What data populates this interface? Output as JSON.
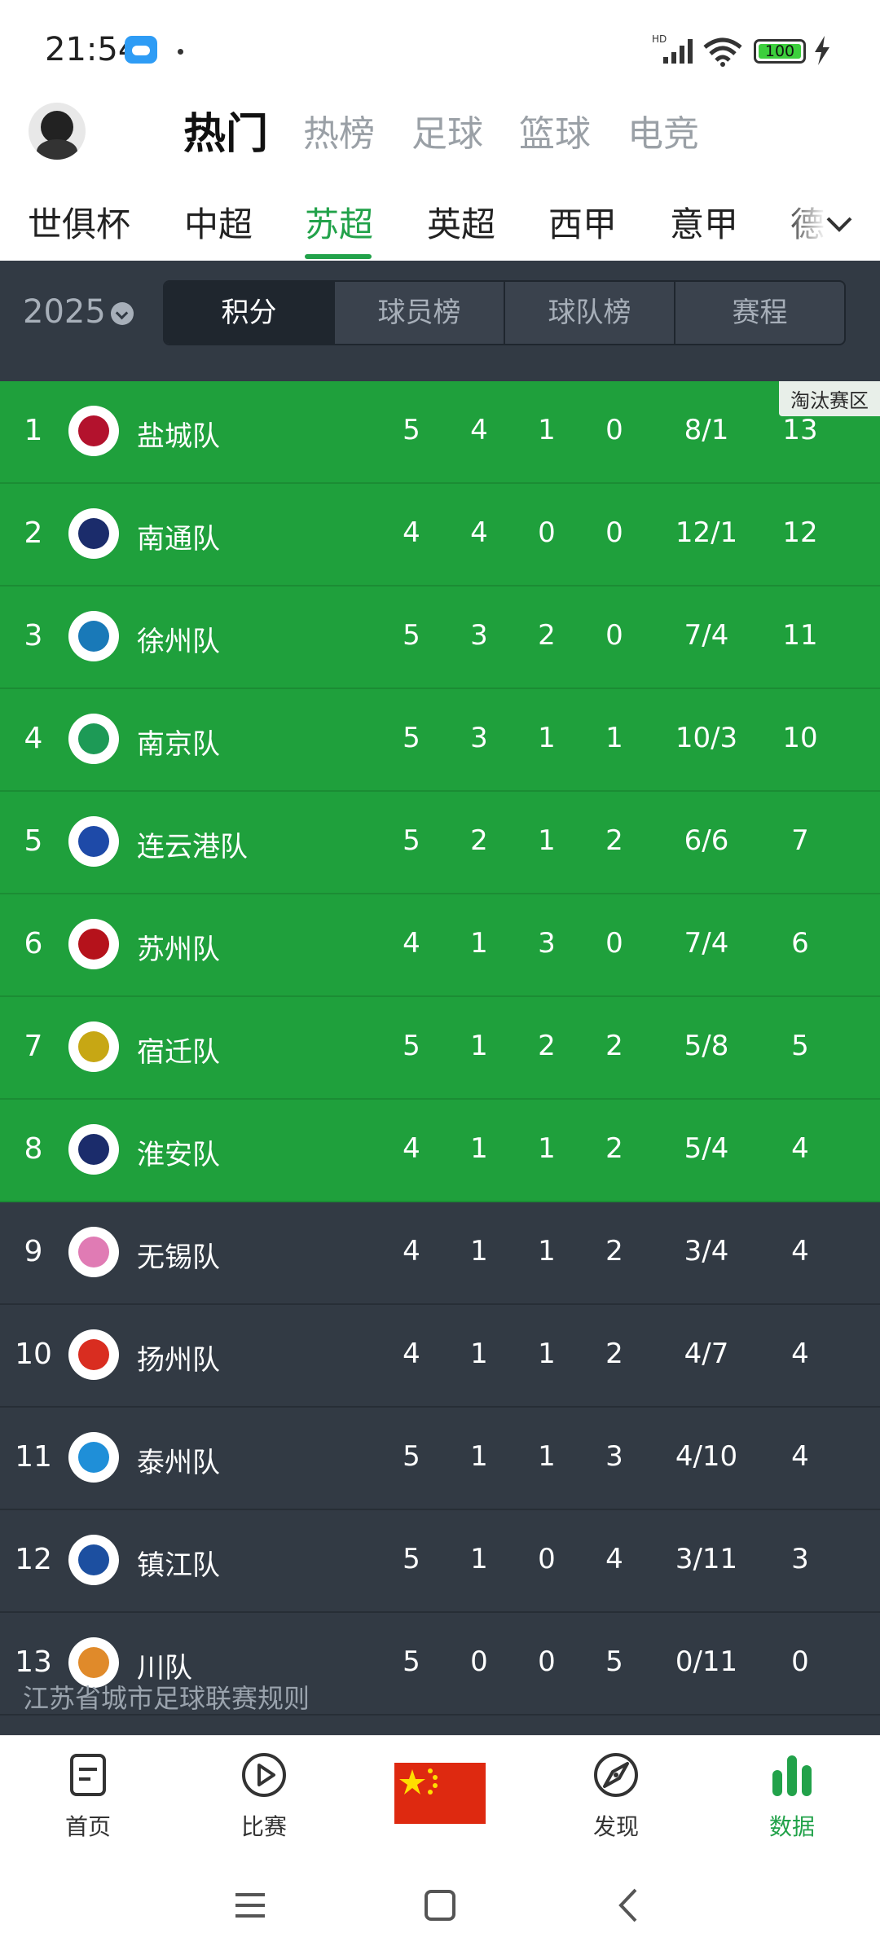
{
  "status_bar": {
    "time": "21:54",
    "battery": "100",
    "signal_label": "HD"
  },
  "top_tabs": [
    {
      "label": "热门",
      "active": true
    },
    {
      "label": "热榜",
      "active": false
    },
    {
      "label": "足球",
      "active": false
    },
    {
      "label": "篮球",
      "active": false
    },
    {
      "label": "电竞",
      "active": false
    }
  ],
  "league_tabs": [
    {
      "label": "世俱杯",
      "active": false
    },
    {
      "label": "中超",
      "active": false
    },
    {
      "label": "苏超",
      "active": true
    },
    {
      "label": "英超",
      "active": false
    },
    {
      "label": "西甲",
      "active": false
    },
    {
      "label": "意甲",
      "active": false
    },
    {
      "label": "德",
      "active": false
    }
  ],
  "season": "2025",
  "segments": [
    {
      "label": "积分",
      "active": true
    },
    {
      "label": "球员榜",
      "active": false
    },
    {
      "label": "球队榜",
      "active": false
    },
    {
      "label": "赛程",
      "active": false
    }
  ],
  "zone_tag": "淘汰赛区",
  "standings": [
    {
      "rank": "1",
      "team": "盐城队",
      "played": "5",
      "won": "4",
      "drawn": "1",
      "lost": "0",
      "goals": "8/1",
      "points": "13",
      "zone": "knockout",
      "logo_color": "#b3122d"
    },
    {
      "rank": "2",
      "team": "南通队",
      "played": "4",
      "won": "4",
      "drawn": "0",
      "lost": "0",
      "goals": "12/1",
      "points": "12",
      "zone": "knockout",
      "logo_color": "#1b2c6b"
    },
    {
      "rank": "3",
      "team": "徐州队",
      "played": "5",
      "won": "3",
      "drawn": "2",
      "lost": "0",
      "goals": "7/4",
      "points": "11",
      "zone": "knockout",
      "logo_color": "#1979b8"
    },
    {
      "rank": "4",
      "team": "南京队",
      "played": "5",
      "won": "3",
      "drawn": "1",
      "lost": "1",
      "goals": "10/3",
      "points": "10",
      "zone": "knockout",
      "logo_color": "#1d9a56"
    },
    {
      "rank": "5",
      "team": "连云港队",
      "played": "5",
      "won": "2",
      "drawn": "1",
      "lost": "2",
      "goals": "6/6",
      "points": "7",
      "zone": "knockout",
      "logo_color": "#1e4aa8"
    },
    {
      "rank": "6",
      "team": "苏州队",
      "played": "4",
      "won": "1",
      "drawn": "3",
      "lost": "0",
      "goals": "7/4",
      "points": "6",
      "zone": "knockout",
      "logo_color": "#b5121b"
    },
    {
      "rank": "7",
      "team": "宿迁队",
      "played": "5",
      "won": "1",
      "drawn": "2",
      "lost": "2",
      "goals": "5/8",
      "points": "5",
      "zone": "knockout",
      "logo_color": "#c7a714"
    },
    {
      "rank": "8",
      "team": "淮安队",
      "played": "4",
      "won": "1",
      "drawn": "1",
      "lost": "2",
      "goals": "5/4",
      "points": "4",
      "zone": "knockout",
      "logo_color": "#1b2c6b"
    },
    {
      "rank": "9",
      "team": "无锡队",
      "played": "4",
      "won": "1",
      "drawn": "1",
      "lost": "2",
      "goals": "3/4",
      "points": "4",
      "zone": "none",
      "logo_color": "#e07bb4"
    },
    {
      "rank": "10",
      "team": "扬州队",
      "played": "4",
      "won": "1",
      "drawn": "1",
      "lost": "2",
      "goals": "4/7",
      "points": "4",
      "zone": "none",
      "logo_color": "#d92d20"
    },
    {
      "rank": "11",
      "team": "泰州队",
      "played": "5",
      "won": "1",
      "drawn": "1",
      "lost": "3",
      "goals": "4/10",
      "points": "4",
      "zone": "none",
      "logo_color": "#1f8fd8"
    },
    {
      "rank": "12",
      "team": "镇江队",
      "played": "5",
      "won": "1",
      "drawn": "0",
      "lost": "4",
      "goals": "3/11",
      "points": "3",
      "zone": "none",
      "logo_color": "#1c4fa0"
    },
    {
      "rank": "13",
      "team": "川队",
      "played": "5",
      "won": "0",
      "drawn": "0",
      "lost": "5",
      "goals": "0/11",
      "points": "0",
      "zone": "none",
      "logo_color": "#e08a2a"
    }
  ],
  "rules_link": "江苏省城市足球联赛规则",
  "bottom_nav": [
    {
      "label": "首页",
      "icon": "home-doc-icon",
      "active": false
    },
    {
      "label": "比赛",
      "icon": "play-circle-icon",
      "active": false
    },
    {
      "label": "",
      "icon": "china-flag-icon",
      "active": false
    },
    {
      "label": "发现",
      "icon": "compass-icon",
      "active": false
    },
    {
      "label": "数据",
      "icon": "bar-chart-icon",
      "active": true
    }
  ],
  "colors": {
    "accent": "#22a24a",
    "knockout_row": "#1fa03c",
    "dark_bg": "#323a44"
  }
}
